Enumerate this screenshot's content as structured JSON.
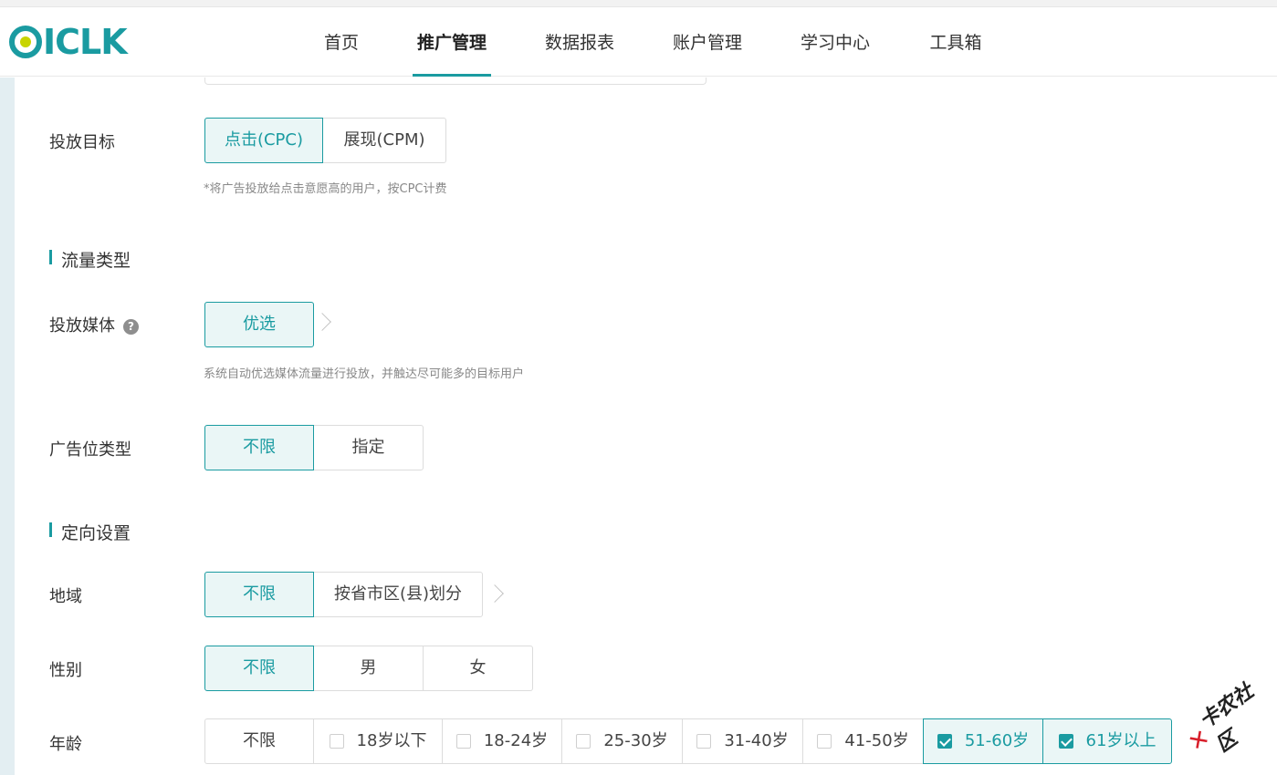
{
  "header": {
    "logo_text": "ICLK",
    "nav": [
      "首页",
      "推广管理",
      "数据报表",
      "账户管理",
      "学习中心",
      "工具箱"
    ],
    "active_nav": "推广管理"
  },
  "form": {
    "goal": {
      "label": "投放目标",
      "options": [
        "点击(CPC)",
        "展现(CPM)"
      ],
      "selected": "点击(CPC)",
      "hint": "*将广告投放给点击意愿高的用户，按CPC计费"
    },
    "traffic_section": "流量类型",
    "media": {
      "label": "投放媒体",
      "help_icon": "?",
      "options": [
        "优选"
      ],
      "selected": "优选",
      "hint": "系统自动优选媒体流量进行投放，并触达尽可能多的目标用户"
    },
    "slot_type": {
      "label": "广告位类型",
      "options": [
        "不限",
        "指定"
      ],
      "selected": "不限"
    },
    "targeting_section": "定向设置",
    "region": {
      "label": "地域",
      "options": [
        "不限",
        "按省市区(县)划分"
      ],
      "selected": "不限"
    },
    "gender": {
      "label": "性别",
      "options": [
        "不限",
        "男",
        "女"
      ],
      "selected": "不限"
    },
    "age": {
      "label": "年龄",
      "options": [
        "不限",
        "18岁以下",
        "18-24岁",
        "25-30岁",
        "31-40岁",
        "41-50岁",
        "51-60岁",
        "61岁以上"
      ],
      "checked": [
        "51-60岁",
        "61岁以上"
      ]
    }
  },
  "watermark": {
    "text": "卡农社区"
  },
  "colors": {
    "accent": "#1a9ba1",
    "selected_bg": "#eaf6f6",
    "logo_dot": "#c8d400"
  }
}
